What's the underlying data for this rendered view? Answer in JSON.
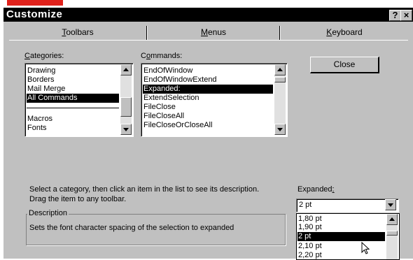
{
  "window": {
    "title": "Customize",
    "help_glyph": "?",
    "close_glyph": "×"
  },
  "tabs": [
    {
      "label": "Toolbars",
      "accel": "T",
      "rest": "oolbars"
    },
    {
      "label": "Menus",
      "accel": "M",
      "rest": "enus"
    },
    {
      "label": "Keyboard",
      "accel": "K",
      "rest": "eyboard"
    }
  ],
  "categories": {
    "label_accel": "C",
    "label_rest": "ategories:",
    "items": [
      "Drawing",
      "Borders",
      "Mail Merge",
      "All Commands",
      "",
      "Macros",
      "Fonts"
    ],
    "selected_index": 3
  },
  "commands": {
    "label_pre": "C",
    "label_accel": "o",
    "label_rest": "mmands:",
    "items": [
      "EndOfWindow",
      "EndOfWindowExtend",
      "Expanded:",
      "ExtendSelection",
      "FileClose",
      "FileCloseAll",
      "FileCloseOrCloseAll"
    ],
    "selected_index": 2
  },
  "close_button": {
    "label": "Close"
  },
  "help_text": {
    "line1": "Select a category, then click an item in the list to see its description.",
    "line2": "Drag the item to any toolbar."
  },
  "description": {
    "legend": "Description",
    "text": "Sets the font character spacing of the selection to expanded"
  },
  "expanded": {
    "label_main": "Expanded",
    "label_accel": ":",
    "value": "2 pt",
    "options": [
      "1,80 pt",
      "1,90 pt",
      "2 pt",
      "2,10 pt",
      "2,20 pt"
    ],
    "selected_index": 2
  }
}
